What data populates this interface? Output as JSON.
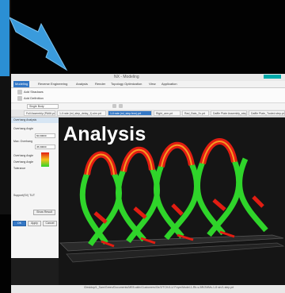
{
  "window": {
    "title": "NX - Modeling",
    "brand": "SIEMENS"
  },
  "menu": {
    "items": [
      "Modeling",
      "Reverse Engineering",
      "Analysis",
      "Render",
      "Topology Optimization",
      "View",
      "Application"
    ]
  },
  "ribbon": {
    "items": [
      "Add Shadows",
      "Add Definition"
    ]
  },
  "toolbar": {
    "filter_value": "Single Body"
  },
  "document_tabs": [
    {
      "label": "Full Assembly (PA66.prt)",
      "active": false
    },
    {
      "label": "1-ll rate (ml_step_delay_1).sim.prt",
      "active": false
    },
    {
      "label": "1-ll rate (ml_step.fem).prt",
      "active": true
    },
    {
      "label": "Right_arm.prt",
      "active": false
    },
    {
      "label": "Rad_Bats_2x.prt",
      "active": false
    },
    {
      "label": "Daffle Plate Assembly_step.prt",
      "active": false
    },
    {
      "label": "Daffle Plate_Tooled.step.prt",
      "active": false
    }
  ],
  "panel": {
    "title": "Overhang Analysis",
    "rows": [
      "Overhang Angle",
      "Max. Overhang",
      "Overhang Angle",
      "Overhang Angle",
      "Tolerance"
    ],
    "field_values": [
      "60.00000",
      "45.00000"
    ],
    "label_side": "Support(SV) TUT",
    "buttons": {
      "show_result": "Show Result",
      "ok": "OK",
      "apply": "Apply",
      "cancel": "Cancel"
    }
  },
  "overlay": {
    "label": "Analysis"
  },
  "status": {
    "path": "/Desktop/1_Sam/Green/Documents/MEB.aktiv/Customers/Ge/2/TCK/4-Lf Foym/Model-1-Rb-s-BR/2MMs-1-8 sin/1-step.prt"
  },
  "colors": {
    "accent": "#3478c6",
    "arrow": "#3a9bdc",
    "lattice_green": "#2fd42a",
    "lattice_red": "#e21d12",
    "lattice_orange": "#f59b22"
  },
  "icons": [
    "arrow-icon",
    "save-icon",
    "undo-icon",
    "redo-icon",
    "gear-icon"
  ]
}
